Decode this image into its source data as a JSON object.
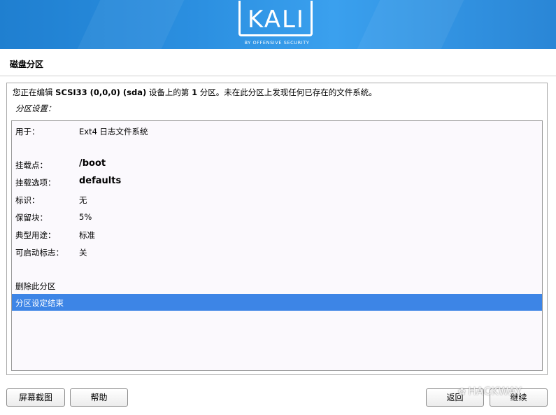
{
  "logo": {
    "text": "KALI",
    "subtitle": "BY OFFENSIVE SECURITY"
  },
  "page_title": "磁盘分区",
  "description": {
    "prefix": "您正在编辑 ",
    "device": "SCSI33 (0,0,0) (sda)",
    "middle": " 设备上的第 ",
    "partition_number": "1",
    "suffix": " 分区。未在此分区上发现任何已存在的文件系统。"
  },
  "settings_label": "分区设置：",
  "settings": [
    {
      "key": "用于：",
      "value": "Ext4 日志文件系统"
    },
    {
      "key": "挂载点：",
      "value": "/boot"
    },
    {
      "key": "挂载选项：",
      "value": "defaults"
    },
    {
      "key": "标识：",
      "value": "无"
    },
    {
      "key": "保留块：",
      "value": "5%"
    },
    {
      "key": "典型用途：",
      "value": "标准"
    },
    {
      "key": "可启动标志：",
      "value": "关"
    }
  ],
  "actions": [
    {
      "label": "删除此分区"
    },
    {
      "label": "分区设定结束",
      "selected": true
    }
  ],
  "buttons": {
    "screenshot": "屏幕截图",
    "help": "帮助",
    "back": "返回",
    "continue": "继续"
  },
  "watermark": "HACKWAY",
  "colors": {
    "banner": "#2b8fe0",
    "selection": "#3d85e6"
  }
}
